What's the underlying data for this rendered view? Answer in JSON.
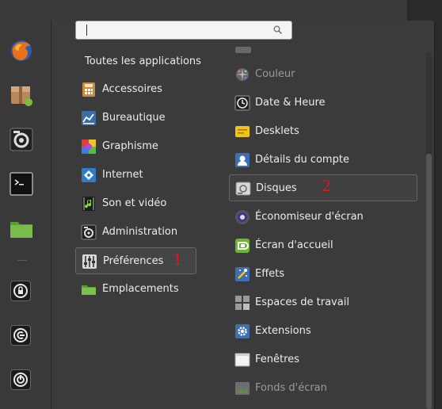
{
  "search": {
    "placeholder": ""
  },
  "all_apps_label": "Toutes les applications",
  "favorites": [
    {
      "name": "firefox-icon"
    },
    {
      "name": "package-icon"
    },
    {
      "name": "settings-icon"
    },
    {
      "name": "terminal-icon"
    },
    {
      "name": "folder-icon"
    }
  ],
  "system_buttons": [
    {
      "name": "lock-icon"
    },
    {
      "name": "logout-icon"
    },
    {
      "name": "power-icon"
    }
  ],
  "categories": [
    {
      "label": "Accessoires",
      "icon": "calculator-icon"
    },
    {
      "label": "Bureautique",
      "icon": "chart-icon"
    },
    {
      "label": "Graphisme",
      "icon": "color-palette-icon"
    },
    {
      "label": "Internet",
      "icon": "globe-icon"
    },
    {
      "label": "Son et vidéo",
      "icon": "media-icon"
    },
    {
      "label": "Administration",
      "icon": "admin-icon"
    },
    {
      "label": "Préférences",
      "icon": "sliders-icon",
      "selected": true
    },
    {
      "label": "Emplacements",
      "icon": "folder-icon"
    }
  ],
  "apps": [
    {
      "label": "Couleur",
      "icon": "color-wheel-icon",
      "dim": true
    },
    {
      "label": "Date & Heure",
      "icon": "clock-icon"
    },
    {
      "label": "Desklets",
      "icon": "note-icon"
    },
    {
      "label": "Détails du compte",
      "icon": "user-icon"
    },
    {
      "label": "Disques",
      "icon": "disk-icon",
      "selected": true
    },
    {
      "label": "Économiseur d'écran",
      "icon": "screensaver-icon"
    },
    {
      "label": "Écran d'accueil",
      "icon": "login-screen-icon"
    },
    {
      "label": "Effets",
      "icon": "effects-icon"
    },
    {
      "label": "Espaces de travail",
      "icon": "workspaces-icon"
    },
    {
      "label": "Extensions",
      "icon": "gear-icon"
    },
    {
      "label": "Fenêtres",
      "icon": "window-icon"
    },
    {
      "label": "Fonds d'écran",
      "icon": "wallpaper-icon",
      "dim": true
    }
  ],
  "annotations": {
    "first": "1",
    "second": "2"
  },
  "colors": {
    "annotation": "#e01818",
    "background": "#3b3b3b",
    "text": "#ececec"
  }
}
